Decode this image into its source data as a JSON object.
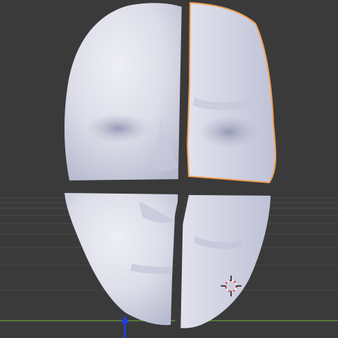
{
  "viewport": {
    "background": "#3a3a3a",
    "grid_color": "#4b4b4b",
    "x_axis_color": "#5f8b3a",
    "y_axis_color": "#1f3fd8",
    "selection_outline_color": "#f0a050",
    "mesh_base_color": "#dfe0ea",
    "mesh_shadow_color": "#9ea1bd"
  },
  "scene": {
    "object": "face-mesh",
    "pieces": [
      "top-left",
      "top-right",
      "bottom-left",
      "bottom-right"
    ],
    "selected_piece": "top-right",
    "cursor": "3d-cursor-icon",
    "gizmo": "z-axis-arrow-icon"
  }
}
